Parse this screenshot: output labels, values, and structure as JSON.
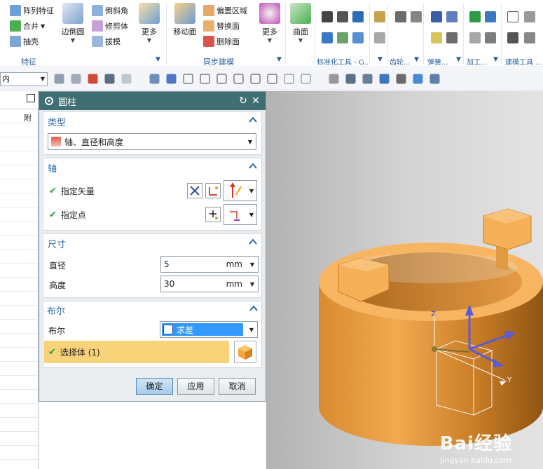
{
  "ribbon": {
    "feature_group": {
      "label": "特征",
      "items": [
        "阵列特征",
        "合并",
        "抽壳"
      ],
      "big": [
        "边倒圆"
      ],
      "small2": [
        "倒斜角",
        "修剪体",
        "拔模"
      ],
      "more": "更多"
    },
    "sync_group": {
      "label": "同步建模",
      "big": "移动面",
      "items": [
        "偏置区域",
        "替换面",
        "删除面"
      ],
      "more": "更多"
    },
    "surface": {
      "label": "曲面"
    },
    "tail_groups": [
      "标准化工具 - G...",
      "齿轮...",
      "弹簧...",
      "加工...",
      "建模工具 ..."
    ]
  },
  "toolbar2": {
    "selection_filter": "内"
  },
  "navigator": {
    "column_header": "附"
  },
  "dialog": {
    "title": "圆柱",
    "sections": {
      "type": {
        "header": "类型",
        "value": "轴、直径和高度"
      },
      "axis": {
        "header": "轴",
        "vector_label": "指定矢量",
        "point_label": "指定点"
      },
      "dimensions": {
        "header": "尺寸",
        "diameter_label": "直径",
        "diameter_value": "5",
        "height_label": "高度",
        "height_value": "30",
        "unit": "mm"
      },
      "boolean": {
        "header": "布尔",
        "boolean_label": "布尔",
        "boolean_value": "求差",
        "select_body": "选择体 (1)"
      }
    },
    "buttons": {
      "ok": "确定",
      "apply": "应用",
      "cancel": "取消"
    }
  },
  "viewport": {
    "axis_labels": {
      "z": "Z",
      "y": "Y"
    },
    "watermark": "Bai经验",
    "watermark_url": "jingyan.baidu.com"
  }
}
